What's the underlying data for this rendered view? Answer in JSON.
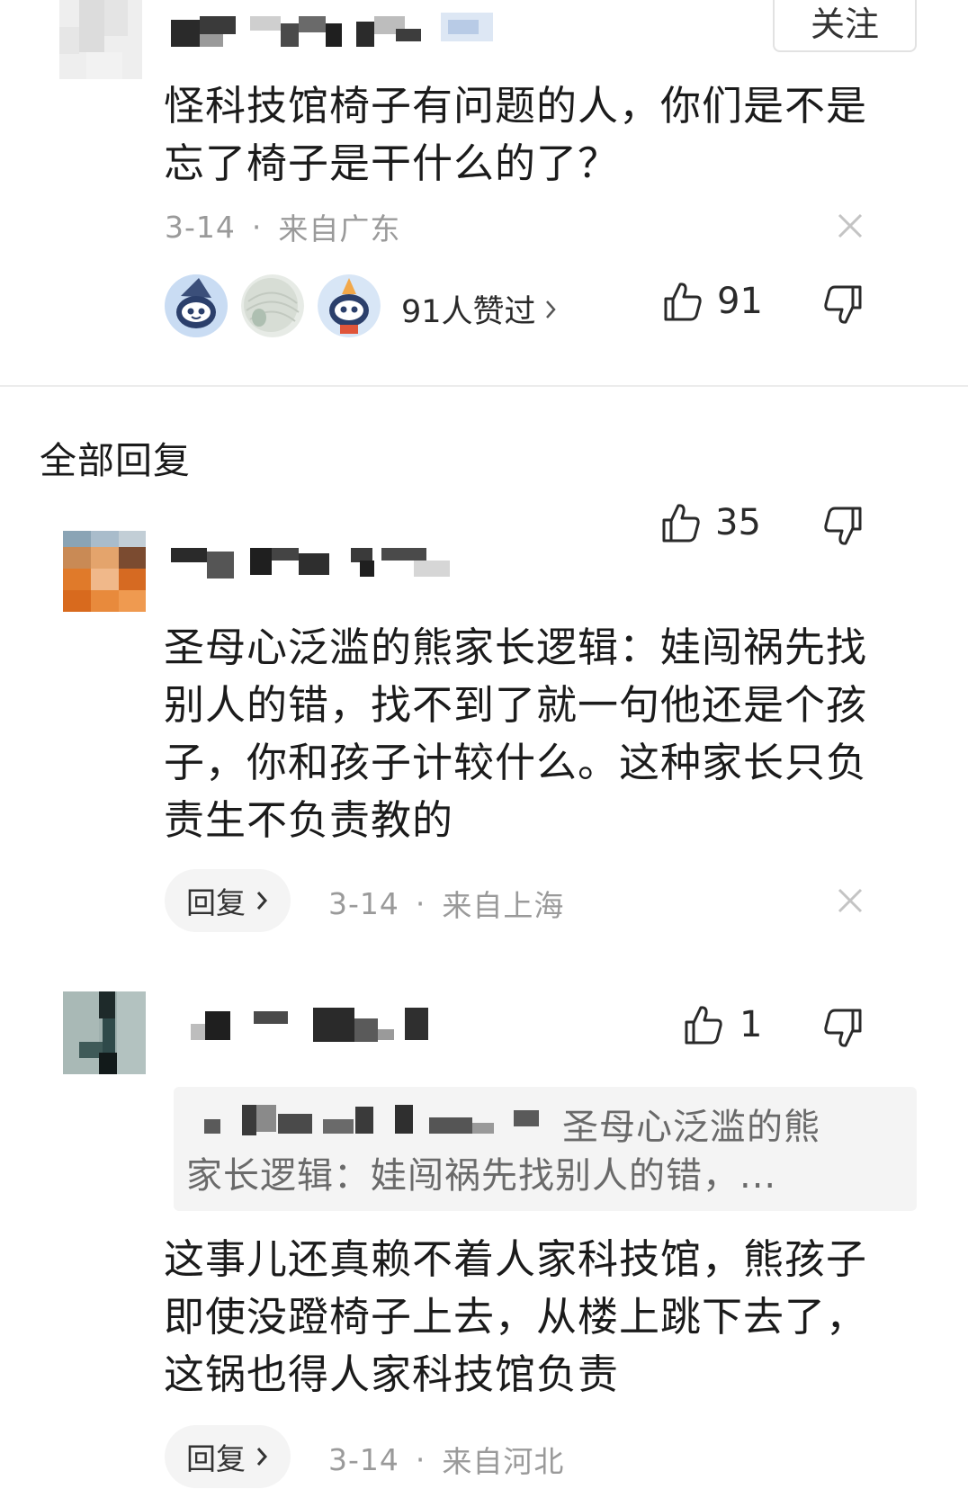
{
  "main_comment": {
    "follow_label": "关注",
    "text_line1": "怪科技馆椅子有问题的人，你们是不是",
    "text_line2": "忘了椅子是干什么的了？",
    "date": "3-14",
    "separator": "·",
    "location": "来自广东",
    "likers_text": "91人赞过",
    "like_count": "91"
  },
  "replies_section": {
    "title": "全部回复"
  },
  "replies": [
    {
      "like_count": "35",
      "text_lines": [
        "圣母心泛滥的熊家长逻辑：娃闯祸先找",
        "别人的错，找不到了就一句他还是个孩",
        "子，你和孩子计较什么。这种家长只负",
        "责生不负责教的"
      ],
      "reply_label": "回复",
      "date": "3-14",
      "separator": "·",
      "location": "来自上海"
    },
    {
      "like_count": "1",
      "quote_line1": "圣母心泛滥的熊",
      "quote_line2": "家长逻辑：娃闯祸先找别人的错，...",
      "text_lines": [
        "这事儿还真赖不着人家科技馆，熊孩子",
        "即使没蹬椅子上去，从楼上跳下去了，",
        "这锅也得人家科技馆负责"
      ],
      "reply_label": "回复",
      "date": "3-14",
      "separator": "·",
      "location": "来自河北"
    }
  ],
  "colors": {
    "text": "#1b1b1b",
    "meta": "#9a9a9a",
    "divider": "#ececec",
    "pill_bg": "#f4f4f4"
  },
  "icons": [
    "thumb-up-icon",
    "thumb-down-icon",
    "close-icon",
    "chevron-right-icon"
  ]
}
